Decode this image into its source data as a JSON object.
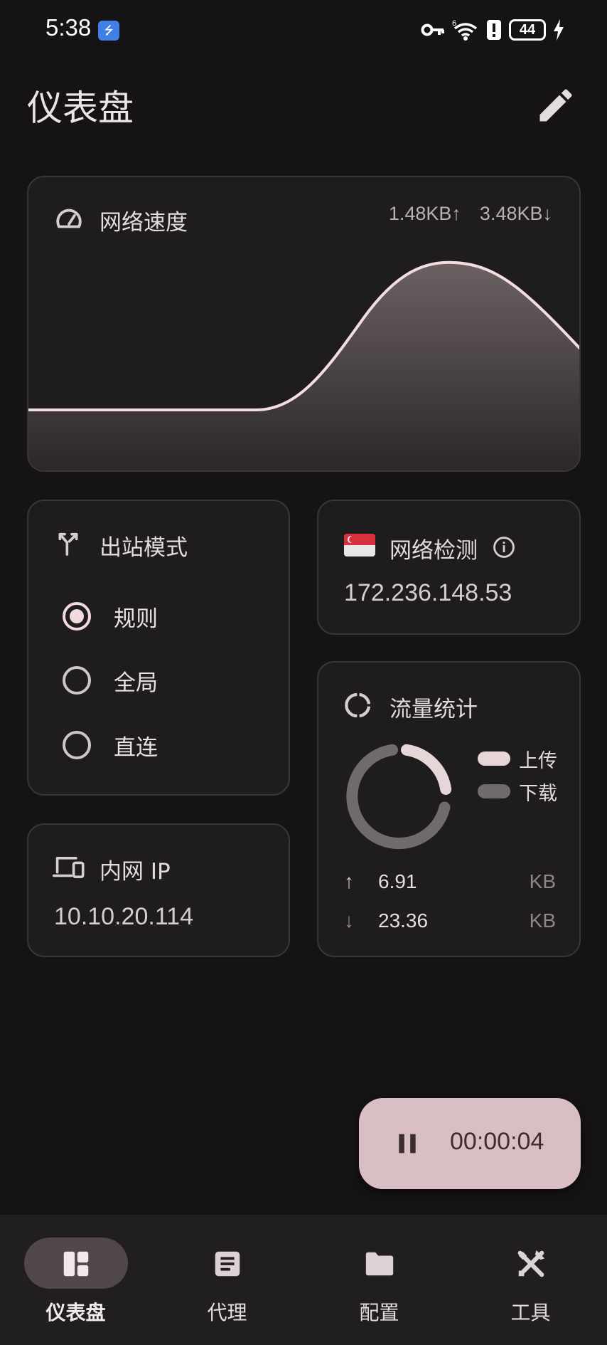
{
  "status_bar": {
    "time": "5:38",
    "battery": "44"
  },
  "header": {
    "title": "仪表盘"
  },
  "network_speed": {
    "title": "网络速度",
    "upload": "1.48KB↑",
    "download": "3.48KB↓"
  },
  "outbound_mode": {
    "title": "出站模式",
    "options": [
      {
        "label": "规则",
        "checked": true
      },
      {
        "label": "全局",
        "checked": false
      },
      {
        "label": "直连",
        "checked": false
      }
    ]
  },
  "lan_ip": {
    "title": "内网 IP",
    "value": "10.10.20.114"
  },
  "network_check": {
    "title": "网络检测",
    "value": "172.236.148.53"
  },
  "traffic": {
    "title": "流量统计",
    "legend_upload": "上传",
    "legend_download": "下载",
    "upload_value": "6.91",
    "upload_unit": "KB",
    "download_value": "23.36",
    "download_unit": "KB"
  },
  "timer": {
    "value": "00:00:04"
  },
  "nav": {
    "items": [
      {
        "label": "仪表盘",
        "icon": "dashboard-icon",
        "active": true
      },
      {
        "label": "代理",
        "icon": "proxy-list-icon",
        "active": false
      },
      {
        "label": "配置",
        "icon": "folder-icon",
        "active": false
      },
      {
        "label": "工具",
        "icon": "tools-icon",
        "active": false
      }
    ]
  },
  "colors": {
    "background": "#151314",
    "card": "#1e1c1d",
    "accent": "#f2d9dd",
    "fab": "#d9bfc3",
    "download_series": "#6f6a6b"
  }
}
